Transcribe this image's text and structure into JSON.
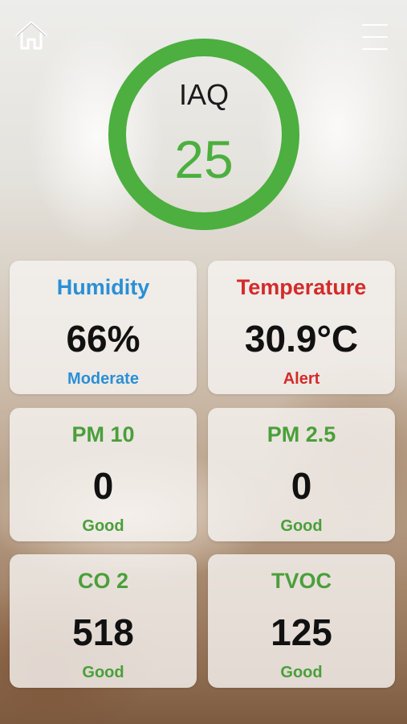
{
  "header": {
    "home_icon": "home-icon",
    "menu_icon": "hamburger-menu-icon"
  },
  "iaq": {
    "label": "IAQ",
    "value": "25",
    "ring_color": "#4caf3f"
  },
  "cards": {
    "humidity": {
      "title": "Humidity",
      "value": "66%",
      "status": "Moderate",
      "color": "#2a8fd6"
    },
    "temperature": {
      "title": "Temperature",
      "value": "30.9°C",
      "status": "Alert",
      "color": "#d32b2b"
    },
    "pm10": {
      "title": "PM 10",
      "value": "0",
      "status": "Good",
      "color": "#4a9f3a"
    },
    "pm25": {
      "title": "PM 2.5",
      "value": "0",
      "status": "Good",
      "color": "#4a9f3a"
    },
    "co2": {
      "title": "CO 2",
      "value": "518",
      "status": "Good",
      "color": "#4a9f3a"
    },
    "tvoc": {
      "title": "TVOC",
      "value": "125",
      "status": "Good",
      "color": "#4a9f3a"
    }
  }
}
